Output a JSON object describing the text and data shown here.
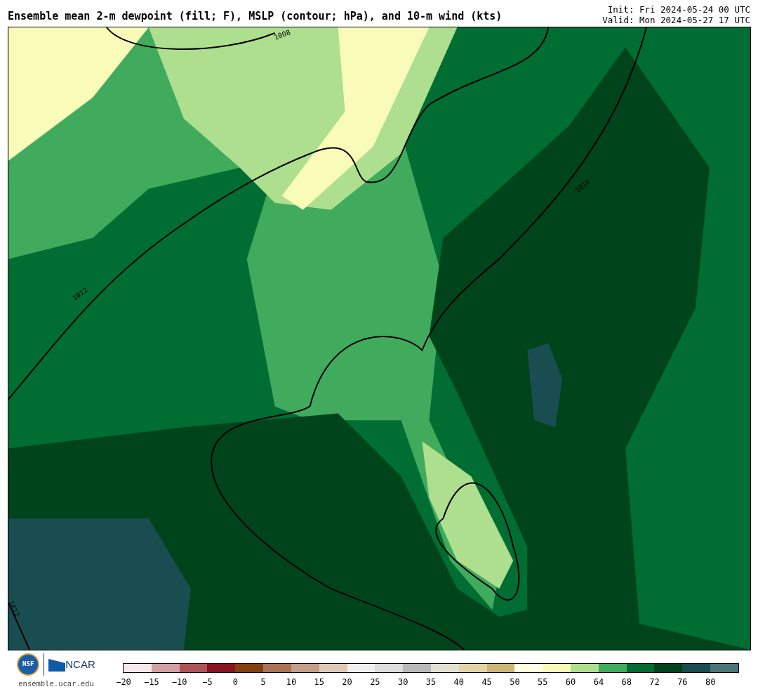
{
  "title": "Ensemble mean 2-m dewpoint (fill; F), MSLP (contour; hPa), and 10-m wind (kts)",
  "init": "Init: Fri 2024-05-24 00 UTC",
  "valid": "Valid: Mon 2024-05-27 17 UTC",
  "map": {
    "contour_labels": [
      "1008",
      "1016",
      "1012",
      "1012"
    ]
  },
  "logos": {
    "nsf": "NSF",
    "ncar": "NCAR",
    "url": "ensemble.ucar.edu"
  },
  "colorbar": {
    "bins": [
      {
        "color": "#f5e9e9"
      },
      {
        "color": "#d49fa3"
      },
      {
        "color": "#ae5459"
      },
      {
        "color": "#8b1220"
      },
      {
        "color": "#84400f"
      },
      {
        "color": "#a87352"
      },
      {
        "color": "#c39f88"
      },
      {
        "color": "#e1c9b7"
      },
      {
        "color": "#f0f0f0"
      },
      {
        "color": "#dcdcdc"
      },
      {
        "color": "#b9b9b9"
      },
      {
        "color": "#e3e2d2"
      },
      {
        "color": "#e3d3a7"
      },
      {
        "color": "#cdb577"
      },
      {
        "color": "#ffffe4"
      },
      {
        "color": "#f8fcb8"
      },
      {
        "color": "#addf8e"
      },
      {
        "color": "#41ab5d"
      },
      {
        "color": "#006d32"
      },
      {
        "color": "#00441b"
      },
      {
        "color": "#1a4d52"
      },
      {
        "color": "#4a7678"
      }
    ],
    "labels": [
      "−20",
      "−15",
      "−10",
      "−5",
      "0",
      "5",
      "10",
      "15",
      "20",
      "25",
      "30",
      "35",
      "40",
      "45",
      "50",
      "55",
      "60",
      "64",
      "68",
      "72",
      "76",
      "80"
    ]
  }
}
